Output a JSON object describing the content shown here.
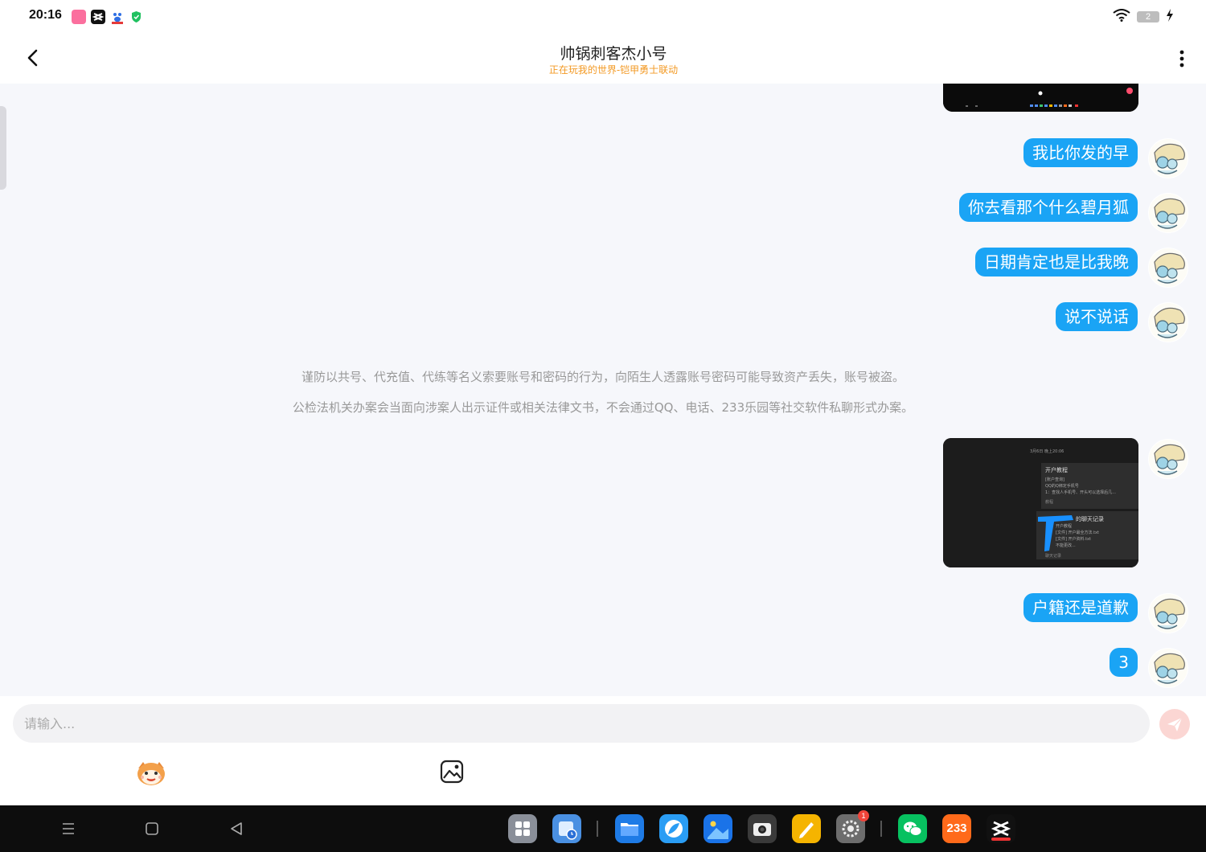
{
  "status_bar": {
    "time": "20:16",
    "battery_level": "2",
    "icons": [
      "bilibili-icon",
      "capcut-icon",
      "baidu-icon",
      "security-shield-icon",
      "wifi-icon",
      "battery-icon",
      "charging-icon"
    ]
  },
  "header": {
    "title": "帅锅刺客杰小号",
    "subtitle": "正在玩我的世界-铠甲勇士联动",
    "back_icon": "chevron-left-icon",
    "more_icon": "more-vertical-icon"
  },
  "chat": {
    "messages_before": [
      {
        "type": "image",
        "from": "me"
      },
      {
        "type": "text",
        "from": "me",
        "text": "我比你发的早"
      },
      {
        "type": "text",
        "from": "me",
        "text": "你去看那个什么碧月狐"
      },
      {
        "type": "text",
        "from": "me",
        "text": "日期肯定也是比我晚"
      },
      {
        "type": "text",
        "from": "me",
        "text": "说不说话"
      }
    ],
    "notice_lines": [
      "谨防以共号、代充值、代练等名义索要账号和密码的行为，向陌生人透露账号密码可能导致资产丢失，账号被盗。",
      "公检法机关办案会当面向涉案人出示证件或相关法律文书，不会通过QQ、电话、233乐园等社交软件私聊形式办案。"
    ],
    "messages_after": [
      {
        "type": "image",
        "from": "me"
      },
      {
        "type": "text",
        "from": "me",
        "text": "户籍还是道歉"
      },
      {
        "type": "text",
        "from": "me",
        "text": "3"
      }
    ],
    "screenshot_texts": {
      "date": "3月6日 晚上20:06",
      "card1_title": "开户教程",
      "card1_line1": "[账户查询]",
      "card1_line2": "QQ的Q绑定手机号",
      "card1_line3": "1：查找人手机号、开头可以选择后几...",
      "card1_footer": "教程",
      "card2_title": "的聊天记录",
      "card2_line1": "开户教程",
      "card2_line2": "[文件] 开户最全方法.txt",
      "card2_line3": "[文件] 开户资料.txt",
      "card2_line4": "不能更改...",
      "card2_footer": "聊天记录"
    }
  },
  "input": {
    "placeholder": "请输入...",
    "send_icon": "send-icon",
    "emoji_icon": "emoji-icon",
    "image_icon": "image-icon"
  },
  "nav_bar": {
    "keys": [
      "menu-icon",
      "home-icon",
      "back-icon"
    ],
    "dock_apps": [
      {
        "name": "app-drawer",
        "color": "#8a8f99"
      },
      {
        "name": "file-clock",
        "color": "#4a90e2"
      },
      {
        "name": "files",
        "color": "#1e7be6"
      },
      {
        "name": "browser",
        "color": "#2a9df4"
      },
      {
        "name": "gallery",
        "color": "#1a73e8"
      },
      {
        "name": "camera",
        "color": "#3a3a3a"
      },
      {
        "name": "notes",
        "color": "#f5b400"
      },
      {
        "name": "settings",
        "color": "#6d6d6d",
        "badge": "1"
      },
      {
        "name": "wechat",
        "color": "#07c160"
      },
      {
        "name": "233-game",
        "color": "#ff6a1a",
        "label": "233"
      },
      {
        "name": "capcut",
        "color": "#111111"
      }
    ]
  }
}
